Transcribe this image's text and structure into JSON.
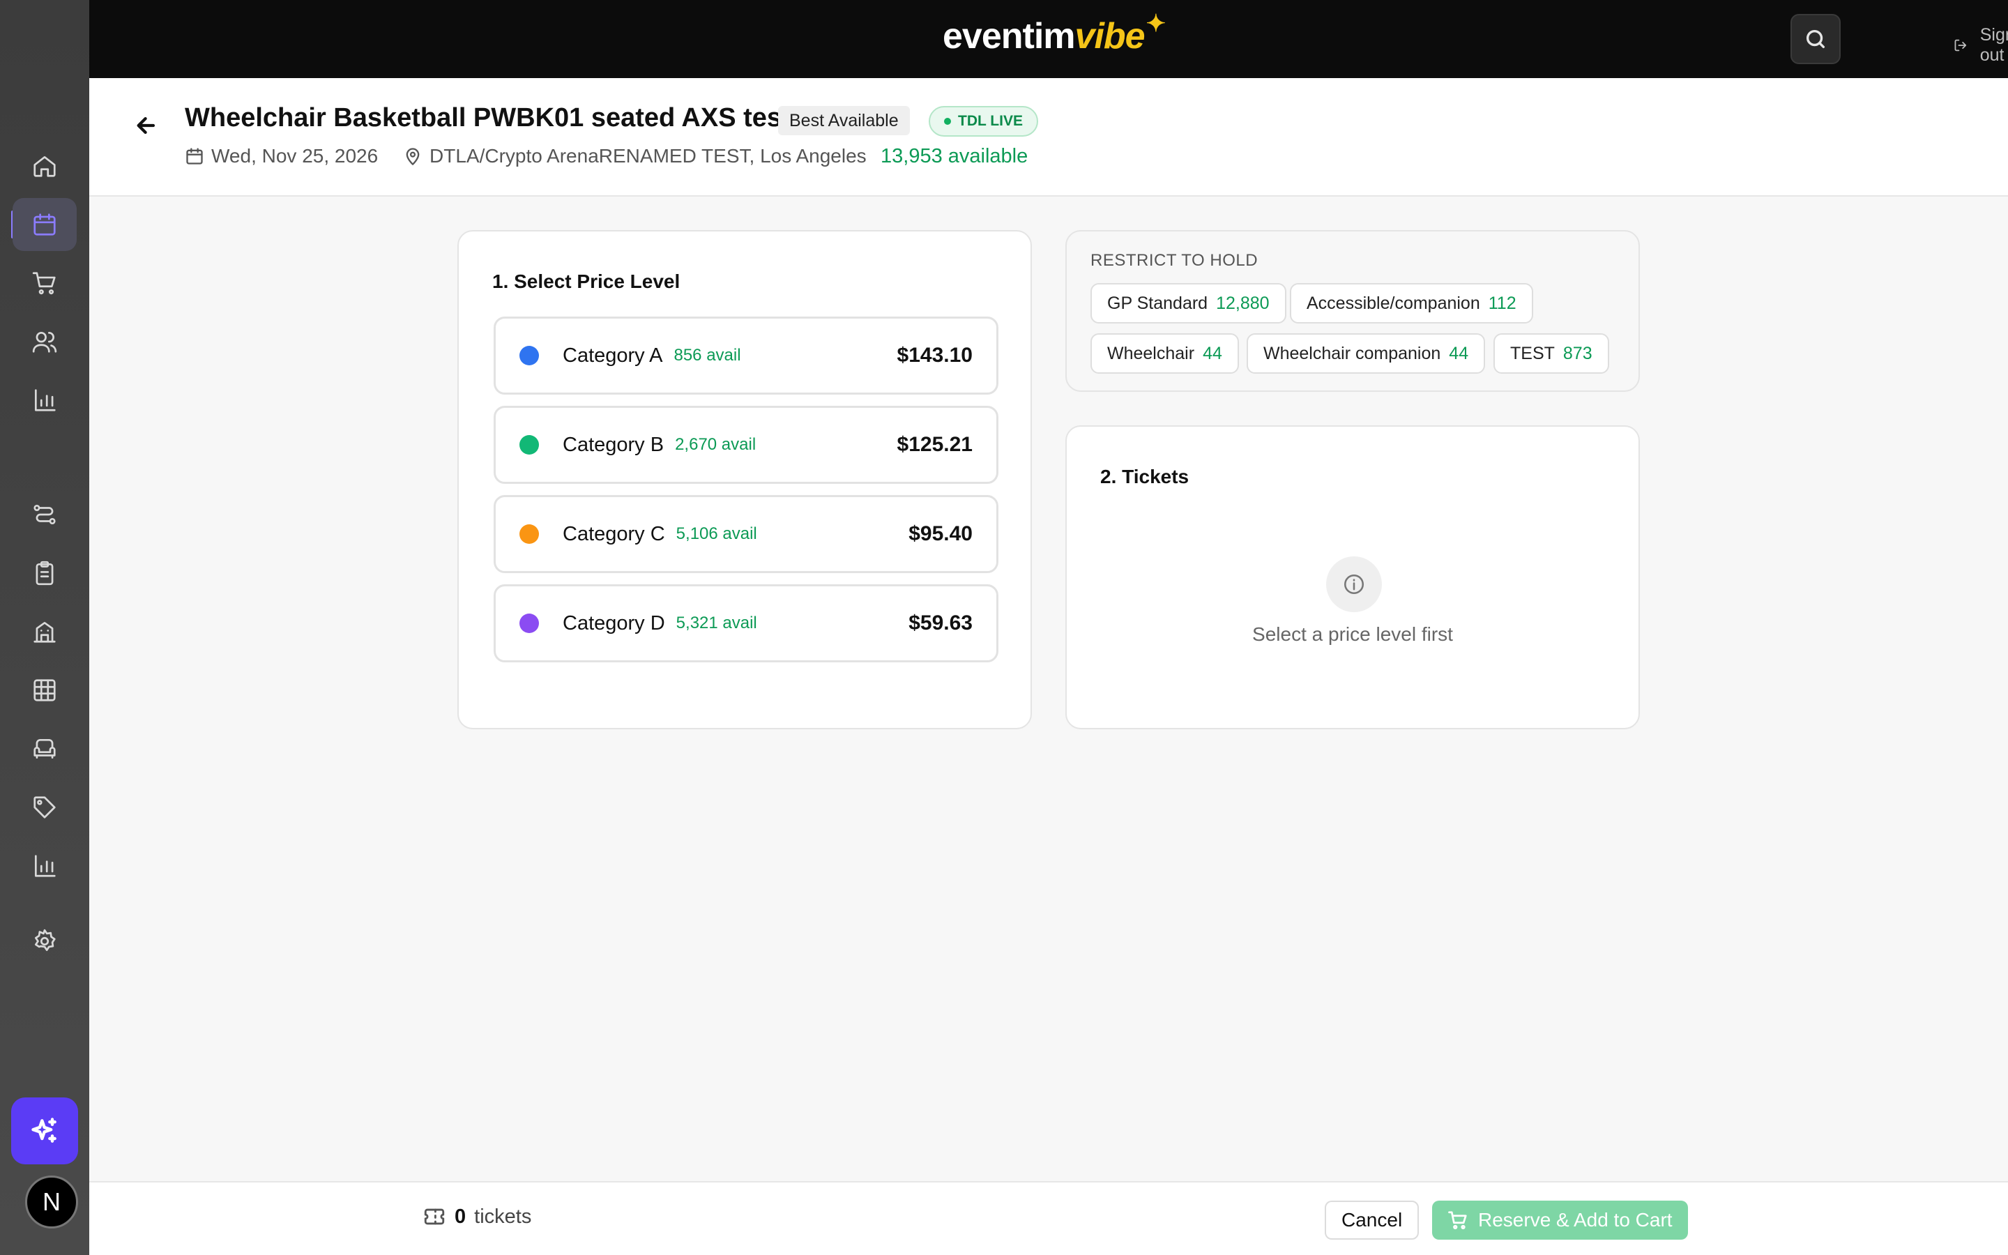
{
  "app": {
    "logo_text_a": "eventim",
    "logo_text_b": "vibe",
    "logo_star": "✦",
    "brand_color": "#f5c518",
    "accent_color": "#5b3cf5"
  },
  "topbar": {
    "search_icon": "search-icon",
    "signout_label": "Sign out"
  },
  "sidebar": {
    "items": [
      {
        "name": "home",
        "icon": "home-icon"
      },
      {
        "name": "events",
        "icon": "calendar-icon",
        "active": true
      },
      {
        "name": "cart",
        "icon": "cart-icon"
      },
      {
        "name": "customers",
        "icon": "users-icon"
      },
      {
        "name": "reports",
        "icon": "bar-chart-icon"
      },
      {
        "name": "flows",
        "icon": "route-icon"
      },
      {
        "name": "orders",
        "icon": "clipboard-icon"
      },
      {
        "name": "venues",
        "icon": "building-icon"
      },
      {
        "name": "seat-maps",
        "icon": "grid-icon"
      },
      {
        "name": "seating",
        "icon": "sofa-icon"
      },
      {
        "name": "pricing",
        "icon": "tag-icon"
      },
      {
        "name": "analytics",
        "icon": "bar-chart-icon"
      },
      {
        "name": "settings",
        "icon": "gear-icon"
      }
    ],
    "ai_icon": "sparkles-icon",
    "avatar_initial": "N"
  },
  "event": {
    "title": "Wheelchair Basketball PWBK01 seated AXS test",
    "mode_badge": "Best Available",
    "status_badge": "TDL LIVE",
    "date": "Wed, Nov 25, 2026",
    "venue": "DTLA/Crypto ArenaRENAMED TEST, Los Angeles",
    "available": "13,953 available"
  },
  "price_levels": {
    "title": "1. Select Price Level",
    "items": [
      {
        "name": "Category A",
        "avail": "856 avail",
        "price": "$143.10",
        "color": "#2f74f0"
      },
      {
        "name": "Category B",
        "avail": "2,670 avail",
        "price": "$125.21",
        "color": "#12b876"
      },
      {
        "name": "Category C",
        "avail": "5,106 avail",
        "price": "$95.40",
        "color": "#fa9513"
      },
      {
        "name": "Category D",
        "avail": "5,321 avail",
        "price": "$59.63",
        "color": "#8b4cf2"
      }
    ]
  },
  "holds": {
    "label": "RESTRICT TO HOLD",
    "chips": [
      {
        "name": "GP Standard",
        "count": "12,880"
      },
      {
        "name": "Accessible/companion",
        "count": "112"
      },
      {
        "name": "Wheelchair",
        "count": "44"
      },
      {
        "name": "Wheelchair companion",
        "count": "44"
      },
      {
        "name": "TEST",
        "count": "873"
      }
    ]
  },
  "tickets": {
    "title": "2. Tickets",
    "empty_message": "Select a price level first"
  },
  "footer": {
    "ticket_count": "0",
    "ticket_label": "tickets",
    "cancel_label": "Cancel",
    "reserve_label": "Reserve & Add to Cart"
  }
}
